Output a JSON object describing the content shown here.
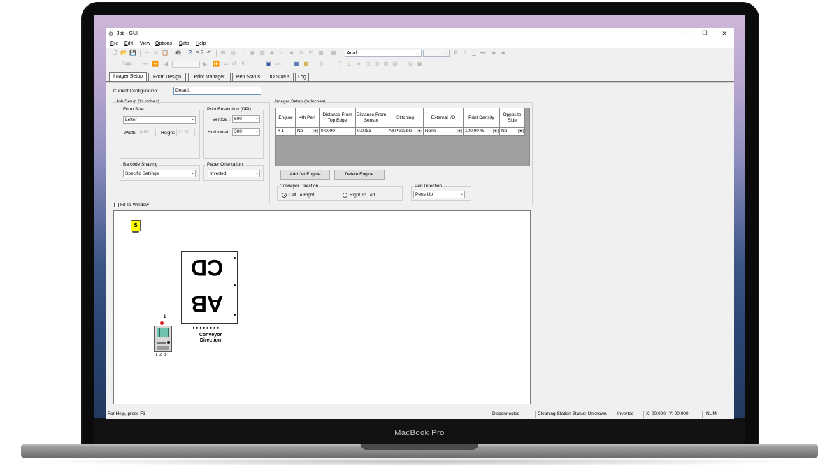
{
  "device": {
    "brand_label": "MacBook Pro"
  },
  "window": {
    "title": "Job - GUI",
    "controls": {
      "minimize": "─",
      "restore": "❐",
      "close": "✕"
    }
  },
  "menu": [
    {
      "label": "File",
      "underline": "F",
      "rest": "ile"
    },
    {
      "label": "Edit",
      "underline": "E",
      "rest": "dit"
    },
    {
      "label": "View",
      "underline": "",
      "rest": "View"
    },
    {
      "label": "Options",
      "underline": "O",
      "rest": "ptions"
    },
    {
      "label": "Data",
      "underline": "D",
      "rest": "ata"
    },
    {
      "label": "Help",
      "underline": "H",
      "rest": "elp"
    }
  ],
  "toolbar": {
    "font_name": "Arial",
    "page_label": "Page:",
    "page_of": "of",
    "page_total": "0",
    "bold": "B",
    "italic": "I",
    "underline": "U",
    "strike": "abc",
    "text_tool": "abc"
  },
  "tabs": [
    "Imager Setup",
    "Form Design",
    "Print Manager",
    "Pen Status",
    "IO Status",
    "Log"
  ],
  "current_configuration": {
    "label": "Current Configuration:",
    "value": "Default"
  },
  "job_setup": {
    "title": "Job Setup (In Inches)",
    "form_size": {
      "label": "Form Size",
      "value": "Letter"
    },
    "width": {
      "label": "Width:",
      "value": "8.50"
    },
    "height": {
      "label": "Height:",
      "value": "11.00"
    },
    "print_resolution": {
      "label": "Print Resolution (DPI)",
      "vertical_label": "Vertical :",
      "vertical_value": "600",
      "horizontal_label": "Horizontal :",
      "horizontal_value": "300"
    },
    "barcode_shaving": {
      "label": "Barcode Shaving",
      "value": "Specific Settings"
    },
    "paper_orientation": {
      "label": "Paper Orientation:",
      "value": "Inverted"
    }
  },
  "imager_setup": {
    "title": "Imager Setup (In Inches)",
    "columns": [
      "Engine",
      "4th Pen",
      "Distance From Top Edge",
      "Distance From Sensor",
      "Stitching",
      "External I/O",
      "Print Density",
      "Opposite Side"
    ],
    "rows": [
      [
        "# 1",
        "No",
        "0.0000",
        "0.0083",
        "All Possible",
        "None",
        "100.00 %",
        "No"
      ]
    ],
    "add_button": "Add Jet Engine",
    "delete_button": "Delete Engine",
    "conveyor": {
      "label": "Conveyor Direction",
      "left_to_right": "Left To Right",
      "right_to_left": "Right To Left",
      "selected": "left_to_right"
    },
    "pen_direction": {
      "label": "Pen Direction",
      "value": "Pens Up"
    }
  },
  "fit_to_window": "Fit To Window",
  "canvas": {
    "sensor_label": "S",
    "engine_number": "1",
    "pen_numbers": "1  2  3",
    "form_text_top": "CD",
    "form_text_bottom": "AB",
    "arrows": "►►►►►►►►",
    "conveyor_label_1": "Conveyor",
    "conveyor_label_2": "Direction"
  },
  "statusbar": {
    "help": "For Help, press F1",
    "connection": "Disconnected",
    "cleaning": "Cleaning Station Status: Unknown",
    "orientation": "Inverted",
    "x": "X: 00.000",
    "y": "Y: 00.000",
    "num": "NUM"
  }
}
